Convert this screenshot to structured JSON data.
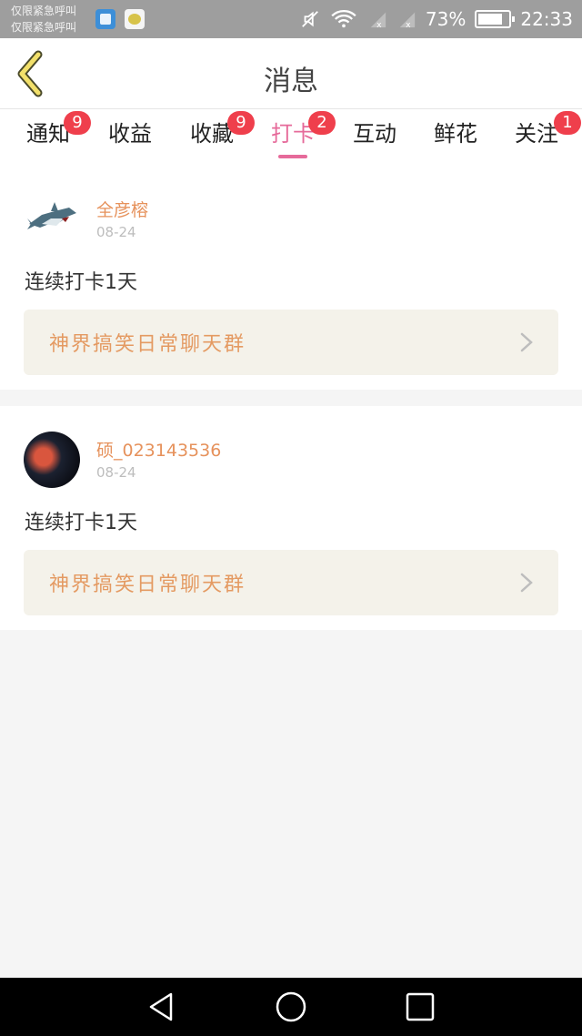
{
  "status_bar": {
    "carrier_line1": "仅限紧急呼叫",
    "carrier_line2": "仅限紧急呼叫",
    "battery": "73%",
    "time": "22:33"
  },
  "header": {
    "title": "消息"
  },
  "tabs": [
    {
      "label": "通知",
      "badge": "9"
    },
    {
      "label": "收益",
      "badge": ""
    },
    {
      "label": "收藏",
      "badge": "9"
    },
    {
      "label": "打卡",
      "badge": "2"
    },
    {
      "label": "互动",
      "badge": ""
    },
    {
      "label": "鲜花",
      "badge": ""
    },
    {
      "label": "关注",
      "badge": "1"
    }
  ],
  "messages": [
    {
      "username": "全彦榕",
      "date": "08-24",
      "text": "连续打卡1天",
      "group": "神界搞笑日常聊天群"
    },
    {
      "username": "硕_023143536",
      "date": "08-24",
      "text": "连续打卡1天",
      "group": "神界搞笑日常聊天群"
    }
  ],
  "colors": {
    "accent": "#e66a9a",
    "badge": "#ef3f4c",
    "name": "#e6925c",
    "group_text": "#e49a62"
  }
}
